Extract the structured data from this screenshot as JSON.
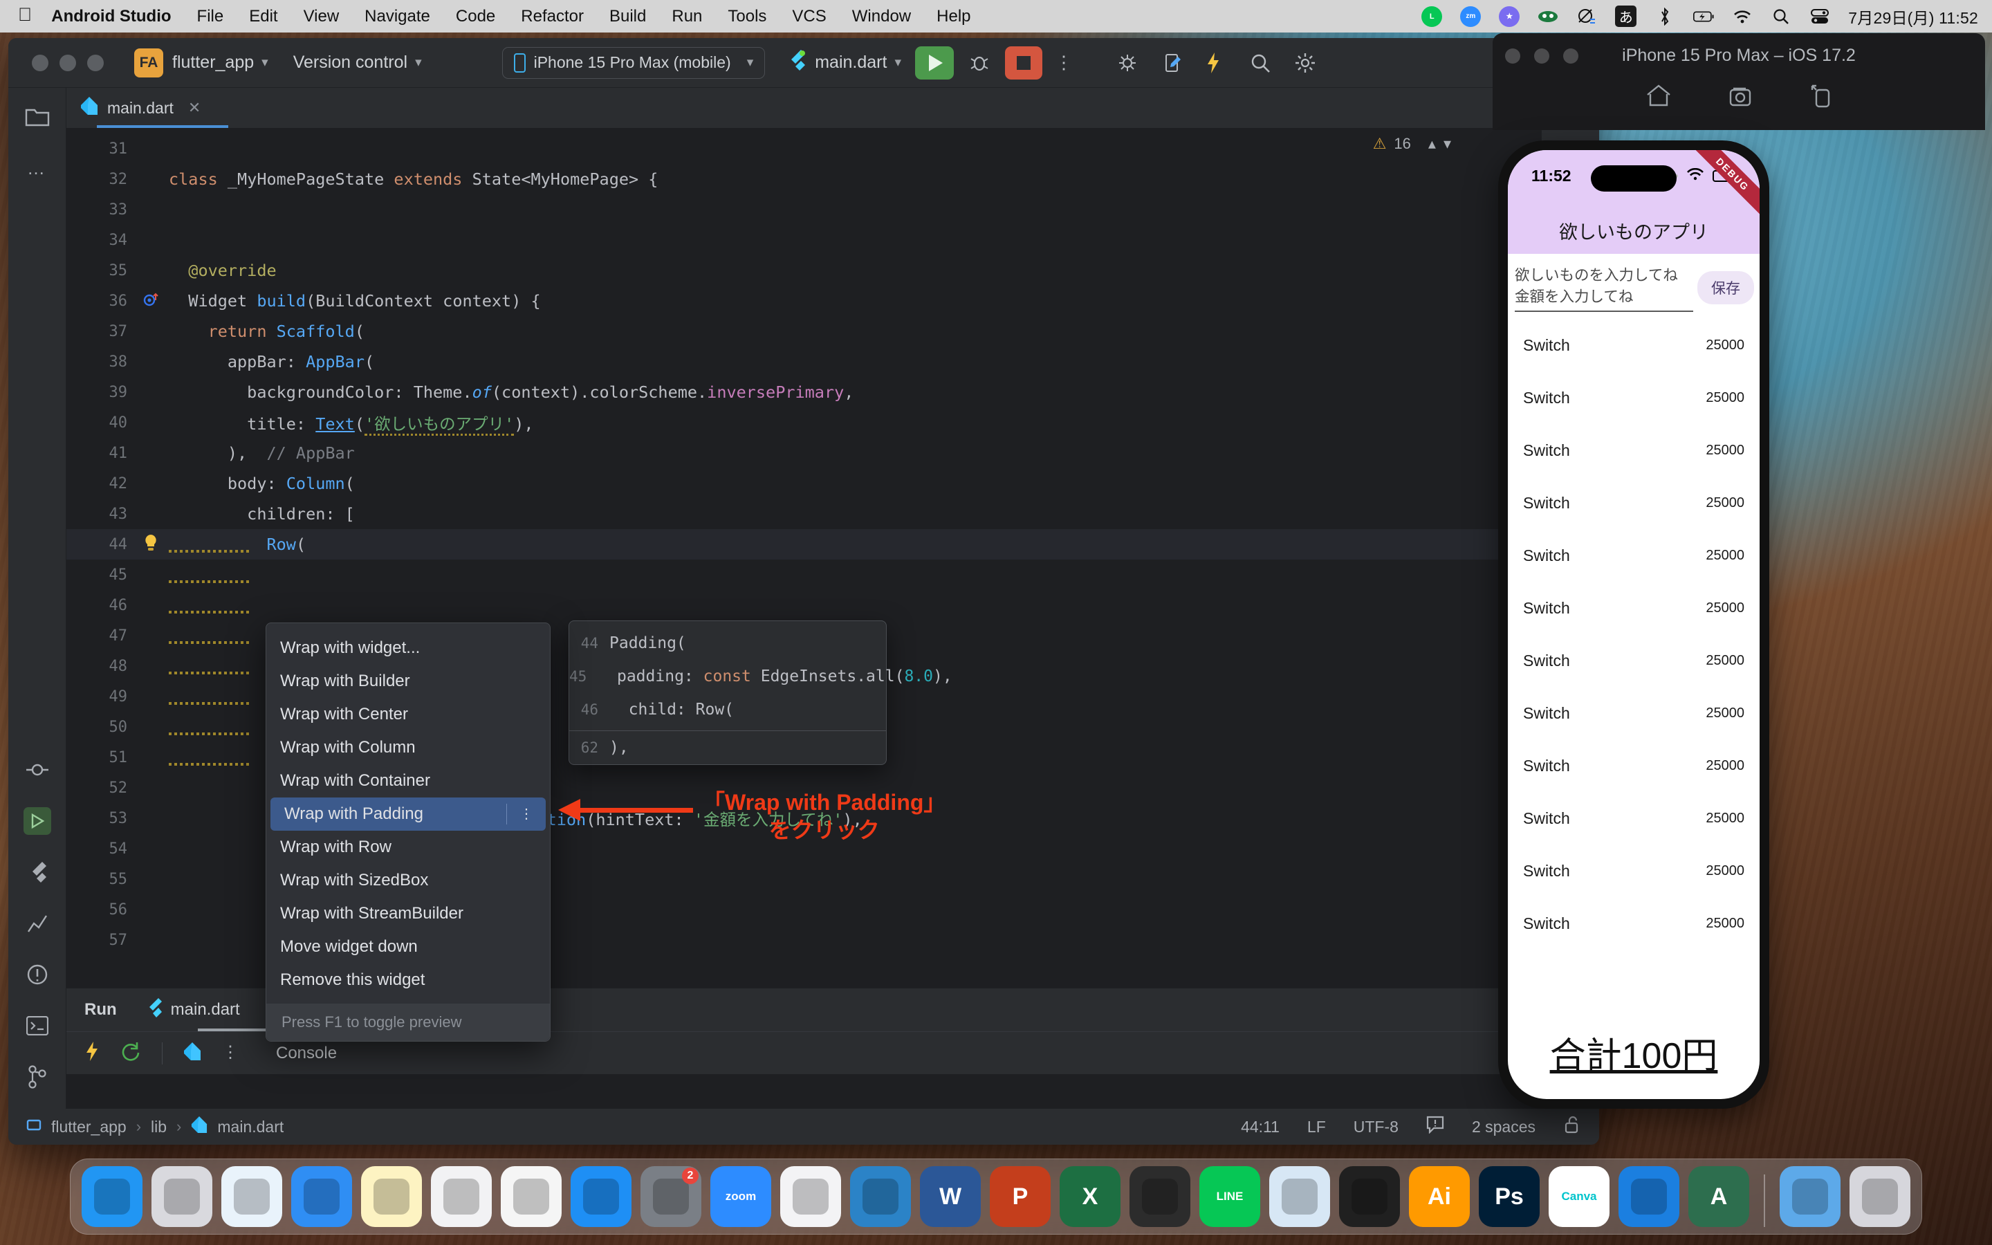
{
  "menubar": {
    "apple_icon": "apple-icon",
    "items": [
      "Android Studio",
      "File",
      "Edit",
      "View",
      "Navigate",
      "Code",
      "Refactor",
      "Build",
      "Run",
      "Tools",
      "VCS",
      "Window",
      "Help"
    ],
    "status_icons": [
      "line-icon",
      "zoom-icon",
      "app-icon",
      "antivirus-icon",
      "screen-mirror-icon",
      "ime-icon",
      "bluetooth-icon",
      "battery-charging-icon",
      "wifi-icon",
      "search-icon",
      "control-center-icon"
    ],
    "ime_label": "あ",
    "clock": "7月29日(月) 11:52"
  },
  "ide": {
    "project_badge": "FA",
    "project_name": "flutter_app",
    "version_control": "Version control",
    "device": "iPhone 15 Pro Max (mobile)",
    "run_config": "main.dart",
    "tab": {
      "name": "main.dart",
      "close": "✕"
    },
    "warnings": {
      "count": "16"
    },
    "code_lines": [
      {
        "no": "31",
        "html": ""
      },
      {
        "no": "32",
        "html": "<span class=\"kw\">class</span> _MyHomePageState <span class=\"kw\">extends</span> State&lt;MyHomePage&gt; {"
      },
      {
        "no": "33",
        "html": ""
      },
      {
        "no": "34",
        "html": ""
      },
      {
        "no": "35",
        "html": "  <span style=\"color:#b3ae60\">@override</span>"
      },
      {
        "no": "36",
        "html": "  Widget <span class=\"fn\">build</span>(BuildContext context) {",
        "gicon": "override-marker"
      },
      {
        "no": "37",
        "html": "    <span class=\"kw\">return</span> <span class=\"fn\">Scaffold</span>("
      },
      {
        "no": "38",
        "html": "      appBar: <span class=\"fn\">AppBar</span>("
      },
      {
        "no": "39",
        "html": "        backgroundColor: Theme.<span class=\"it\">of</span>(context).colorScheme.<span style=\"color:#c77dbb\">inversePrimary</span>,"
      },
      {
        "no": "40",
        "html": "        title: <span class=\"fn und\">Text</span>(<span class=\"str squiggle\">'欲しいものアプリ'</span>),"
      },
      {
        "no": "41",
        "html": "      ),  <span class=\"cmt\">// AppBar</span>"
      },
      {
        "no": "42",
        "html": "      body: <span class=\"fn\">Column</span>("
      },
      {
        "no": "43",
        "html": "        children: ["
      },
      {
        "no": "44",
        "html": "          <span class=\"fn\">Row</span>(",
        "gicon": "intention-bulb",
        "highlight": true
      },
      {
        "no": "45",
        "html": ""
      },
      {
        "no": "46",
        "html": ""
      },
      {
        "no": "47",
        "html": ""
      },
      {
        "no": "48",
        "html": ""
      },
      {
        "no": "49",
        "html": ""
      },
      {
        "no": "50",
        "html": ""
      },
      {
        "no": "51",
        "html": ""
      },
      {
        "no": "52",
        "html": ""
      },
      {
        "no": "53",
        "html": "",
        "tail_html": "<span class=\"fn\">coration</span>(hintText: <span class=\"str\">'金額を入力してね'</span>),"
      },
      {
        "no": "54",
        "html": ""
      },
      {
        "no": "55",
        "html": ""
      },
      {
        "no": "56",
        "html": ""
      },
      {
        "no": "57",
        "html": ""
      }
    ],
    "context_menu": {
      "items": [
        "Wrap with widget...",
        "Wrap with Builder",
        "Wrap with Center",
        "Wrap with Column",
        "Wrap with Container",
        "Wrap with Padding",
        "Wrap with Row",
        "Wrap with SizedBox",
        "Wrap with StreamBuilder",
        "Move widget down",
        "Remove this widget"
      ],
      "selected_index": 5,
      "footer": "Press F1 to toggle preview"
    },
    "preview_popup": {
      "lines": [
        {
          "no": "44",
          "html": "Padding("
        },
        {
          "no": "45",
          "html": "  padding: <span class=\"kw\">const</span> EdgeInsets.all(<span class=\"num\">8.0</span>),"
        },
        {
          "no": "46",
          "html": "  child: Row("
        }
      ],
      "footer_line": {
        "no": "62",
        "html": "),"
      }
    },
    "annotation": {
      "line1": "「Wrap with Padding」",
      "line2": "をクリック"
    },
    "run_panel": {
      "run_label": "Run",
      "run_tab": "main.dart",
      "console_label": "Console"
    },
    "statusbar": {
      "breadcrumb": [
        "flutter_app",
        "lib",
        "main.dart"
      ],
      "caret": "44:11",
      "line_sep": "LF",
      "encoding": "UTF-8",
      "indent": "2 spaces"
    }
  },
  "simulator": {
    "title": "iPhone 15 Pro Max – iOS 17.2",
    "toolbar_icons": [
      "home-icon",
      "screenshot-icon",
      "rotate-icon"
    ],
    "app": {
      "status_time": "11:52",
      "app_title": "欲しいものアプリ",
      "debug_ribbon": "DEBUG",
      "field1_hint": "欲しいものを入力してね",
      "field2_hint": "金額を入力してね",
      "save_button": "保存",
      "items": [
        {
          "name": "Switch",
          "price": "25000"
        },
        {
          "name": "Switch",
          "price": "25000"
        },
        {
          "name": "Switch",
          "price": "25000"
        },
        {
          "name": "Switch",
          "price": "25000"
        },
        {
          "name": "Switch",
          "price": "25000"
        },
        {
          "name": "Switch",
          "price": "25000"
        },
        {
          "name": "Switch",
          "price": "25000"
        },
        {
          "name": "Switch",
          "price": "25000"
        },
        {
          "name": "Switch",
          "price": "25000"
        },
        {
          "name": "Switch",
          "price": "25000"
        },
        {
          "name": "Switch",
          "price": "25000"
        },
        {
          "name": "Switch",
          "price": "25000"
        }
      ],
      "total": "合計100円"
    }
  },
  "dock": {
    "items": [
      {
        "name": "finder-icon",
        "label": "",
        "color": "#2196f3"
      },
      {
        "name": "launchpad-icon",
        "label": "",
        "color": "#d9d9de"
      },
      {
        "name": "safari-icon",
        "label": "",
        "color": "#e9f3fb"
      },
      {
        "name": "mail-icon",
        "label": "",
        "color": "#2f8ef4"
      },
      {
        "name": "notes-icon",
        "label": "",
        "color": "#fdf3c2"
      },
      {
        "name": "stocks-icon",
        "label": "",
        "color": "#f2f2f4"
      },
      {
        "name": "chrome-icon",
        "label": "",
        "color": "#f5f5f5"
      },
      {
        "name": "appstore-icon",
        "label": "",
        "color": "#1e8ff5"
      },
      {
        "name": "settings-icon",
        "label": "",
        "color": "#7a7f86",
        "badge": "2"
      },
      {
        "name": "zoom-icon",
        "label": "zoom",
        "color": "#2d8cff"
      },
      {
        "name": "slack-icon",
        "label": "",
        "color": "#f3f3f5"
      },
      {
        "name": "vscode-icon",
        "label": "",
        "color": "#2b83c7"
      },
      {
        "name": "word-icon",
        "label": "W",
        "color": "#2b5797"
      },
      {
        "name": "powerpoint-icon",
        "label": "P",
        "color": "#c43e1c"
      },
      {
        "name": "excel-icon",
        "label": "X",
        "color": "#1d6f42"
      },
      {
        "name": "figma-icon",
        "label": "",
        "color": "#2c2c2c"
      },
      {
        "name": "line-icon",
        "label": "LINE",
        "color": "#06c755"
      },
      {
        "name": "preview-icon",
        "label": "",
        "color": "#d7e7f5"
      },
      {
        "name": "photos-icon",
        "label": "",
        "color": "#202020"
      },
      {
        "name": "illustrator-icon",
        "label": "Ai",
        "color": "#ff9a00"
      },
      {
        "name": "photoshop-icon",
        "label": "Ps",
        "color": "#001e36"
      },
      {
        "name": "canva-icon",
        "label": "Canva",
        "color": "#ffffff"
      },
      {
        "name": "xcode-icon",
        "label": "",
        "color": "#1b7fe0"
      },
      {
        "name": "android-studio-icon",
        "label": "A",
        "color": "#2d6e4e"
      },
      {
        "name": "downloads-icon",
        "label": "",
        "color": "#5da9e9"
      },
      {
        "name": "trash-icon",
        "label": "",
        "color": "#d6d6dc"
      }
    ]
  }
}
